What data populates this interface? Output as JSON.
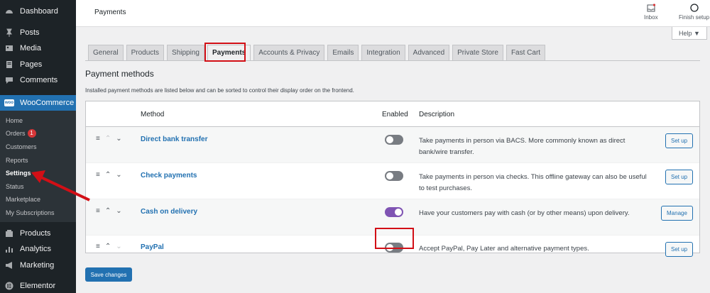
{
  "sidebar": {
    "top_items": [
      {
        "label": "Dashboard",
        "icon": "dashboard-icon"
      },
      {
        "label": "Posts",
        "icon": "pin-icon"
      },
      {
        "label": "Media",
        "icon": "media-icon"
      },
      {
        "label": "Pages",
        "icon": "page-icon"
      },
      {
        "label": "Comments",
        "icon": "comment-icon"
      }
    ],
    "woocommerce": {
      "label": "WooCommerce",
      "icon_text": "woo"
    },
    "sub_items": [
      {
        "label": "Home"
      },
      {
        "label": "Orders",
        "badge": "1"
      },
      {
        "label": "Customers"
      },
      {
        "label": "Reports"
      },
      {
        "label": "Settings"
      },
      {
        "label": "Status"
      },
      {
        "label": "Marketplace"
      },
      {
        "label": "My Subscriptions"
      }
    ],
    "bottom_items": [
      {
        "label": "Products",
        "icon": "products-icon"
      },
      {
        "label": "Analytics",
        "icon": "analytics-icon"
      },
      {
        "label": "Marketing",
        "icon": "megaphone-icon"
      },
      {
        "label": "Elementor",
        "icon": "elementor-icon"
      }
    ]
  },
  "topbar": {
    "title": "Payments",
    "inbox": "Inbox",
    "finish_setup": "Finish setup",
    "help": "Help ▼"
  },
  "tabs": [
    "General",
    "Products",
    "Shipping",
    "Payments",
    "Accounts & Privacy",
    "Emails",
    "Integration",
    "Advanced",
    "Private Store",
    "Fast Cart"
  ],
  "active_tab": "Payments",
  "section": {
    "title": "Payment methods",
    "description": "Installed payment methods are listed below and can be sorted to control their display order on the frontend."
  },
  "table": {
    "headers": {
      "method": "Method",
      "enabled": "Enabled",
      "description": "Description"
    },
    "rows": [
      {
        "method": "Direct bank transfer",
        "enabled": false,
        "description": "Take payments in person via BACS. More commonly known as direct bank/wire transfer.",
        "action": "Set up"
      },
      {
        "method": "Check payments",
        "enabled": false,
        "description": "Take payments in person via checks. This offline gateway can also be useful to test purchases.",
        "action": "Set up"
      },
      {
        "method": "Cash on delivery",
        "enabled": true,
        "description": "Have your customers pay with cash (or by other means) upon delivery.",
        "action": "Manage"
      },
      {
        "method": "PayPal",
        "enabled": false,
        "description": "Accept PayPal, Pay Later and alternative payment types.",
        "action": "Set up"
      }
    ]
  },
  "save_button": "Save changes",
  "colors": {
    "sidebar_bg": "#1d2327",
    "accent": "#2271b1",
    "toggle_on": "#7f54b3",
    "highlight": "#d20f16",
    "badge": "#d63638"
  }
}
